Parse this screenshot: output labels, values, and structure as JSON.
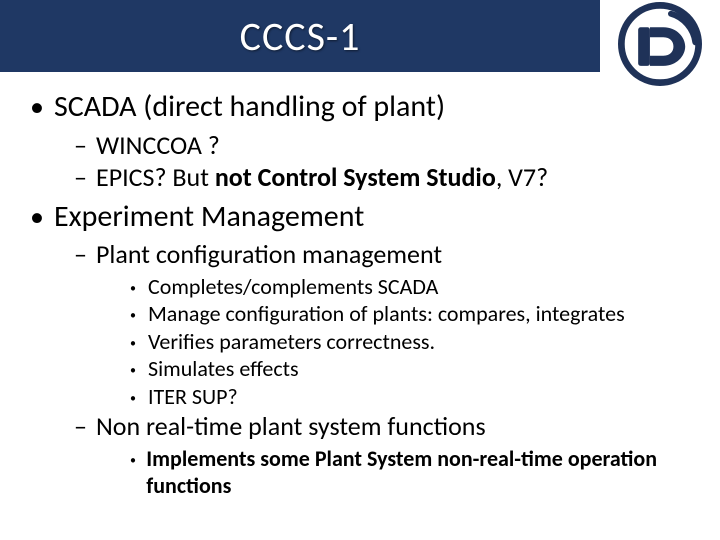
{
  "title": "CCCS-1",
  "bullets": [
    {
      "text": "SCADA (direct handling of plant)",
      "children": [
        {
          "text": "WINCCOA ?"
        },
        {
          "text_html": "EPICS? But <b>not Control System Studio</b>, V7?"
        }
      ]
    },
    {
      "text": "Experiment Management",
      "children": [
        {
          "text": "Plant configuration management",
          "children": [
            {
              "text": "Completes/complements SCADA"
            },
            {
              "text": "Manage configuration of plants: compares, integrates"
            },
            {
              "text": "Verifies parameters correctness."
            },
            {
              "text": "Simulates effects"
            },
            {
              "text": "ITER SUP?"
            }
          ]
        },
        {
          "text": "Non real-time plant system functions",
          "children": [
            {
              "text_html": "<b>Implements some Plant System non-real-time operation functions</b>"
            }
          ]
        }
      ]
    }
  ]
}
